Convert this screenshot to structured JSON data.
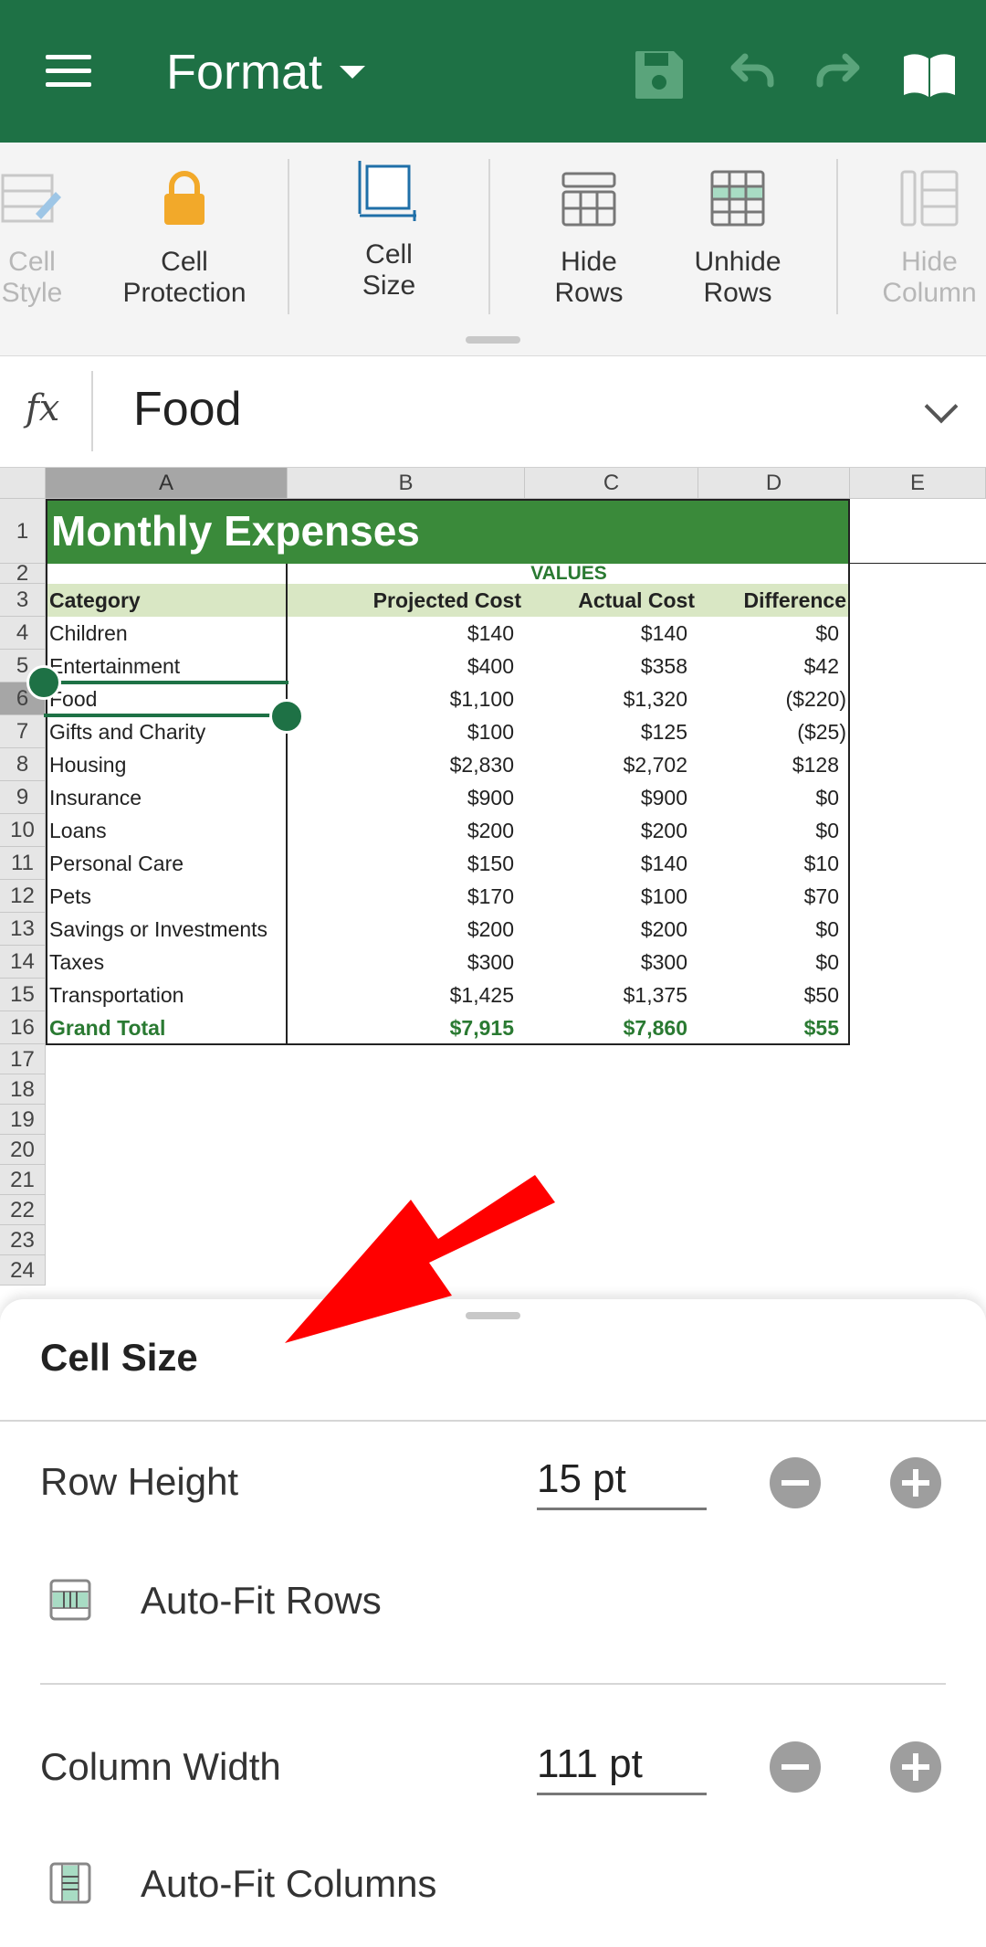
{
  "appbar": {
    "title": "Format",
    "icons": [
      "menu-icon",
      "save-icon",
      "undo-icon",
      "redo-icon",
      "book-icon"
    ]
  },
  "ribbon": {
    "items": [
      {
        "label1": "Cell",
        "label2": "Style",
        "icon": "cell-style-icon"
      },
      {
        "label1": "Cell",
        "label2": "Protection",
        "icon": "lock-icon"
      },
      {
        "label1": "Cell",
        "label2": "Size",
        "icon": "cell-size-icon"
      },
      {
        "label1": "Hide",
        "label2": "Rows",
        "icon": "hide-rows-icon"
      },
      {
        "label1": "Unhide",
        "label2": "Rows",
        "icon": "unhide-rows-icon"
      },
      {
        "label1": "Hide",
        "label2": "Column",
        "icon": "hide-column-icon"
      }
    ]
  },
  "formula_bar": {
    "fx": "fx",
    "value": "Food"
  },
  "sheet_grid": {
    "columns": [
      "A",
      "B",
      "C",
      "D",
      "E"
    ],
    "rows": [
      "1",
      "2",
      "3",
      "4",
      "5",
      "6",
      "7",
      "8",
      "9",
      "10",
      "11",
      "12",
      "13",
      "14",
      "15",
      "16",
      "17",
      "18",
      "19",
      "20",
      "21",
      "22",
      "23",
      "24"
    ],
    "title": "Monthly Expenses",
    "values_header": "VALUES",
    "headers": [
      "Category",
      "Projected Cost",
      "Actual Cost",
      "Difference"
    ],
    "data": [
      [
        "Children",
        "$140",
        "$140",
        "$0"
      ],
      [
        "Entertainment",
        "$400",
        "$358",
        "$42"
      ],
      [
        "Food",
        "$1,100",
        "$1,320",
        "($220)"
      ],
      [
        "Gifts and Charity",
        "$100",
        "$125",
        "($25)"
      ],
      [
        "Housing",
        "$2,830",
        "$2,702",
        "$128"
      ],
      [
        "Insurance",
        "$900",
        "$900",
        "$0"
      ],
      [
        "Loans",
        "$200",
        "$200",
        "$0"
      ],
      [
        "Personal Care",
        "$150",
        "$140",
        "$10"
      ],
      [
        "Pets",
        "$170",
        "$100",
        "$70"
      ],
      [
        "Savings or Investments",
        "$200",
        "$200",
        "$0"
      ],
      [
        "Taxes",
        "$300",
        "$300",
        "$0"
      ],
      [
        "Transportation",
        "$1,425",
        "$1,375",
        "$50"
      ]
    ],
    "total": [
      "Grand Total",
      "$7,915",
      "$7,860",
      "$55"
    ]
  },
  "cell_size_sheet": {
    "title": "Cell Size",
    "row_height_label": "Row Height",
    "row_height_value": "15 pt",
    "autofit_rows": "Auto-Fit Rows",
    "column_width_label": "Column Width",
    "column_width_value": "111 pt",
    "autofit_columns": "Auto-Fit Columns"
  },
  "colors": {
    "brand": "#1e7145",
    "title_fill": "#3a8a3a",
    "header_fill": "#d9e7c4",
    "arrow": "#ff0000"
  }
}
